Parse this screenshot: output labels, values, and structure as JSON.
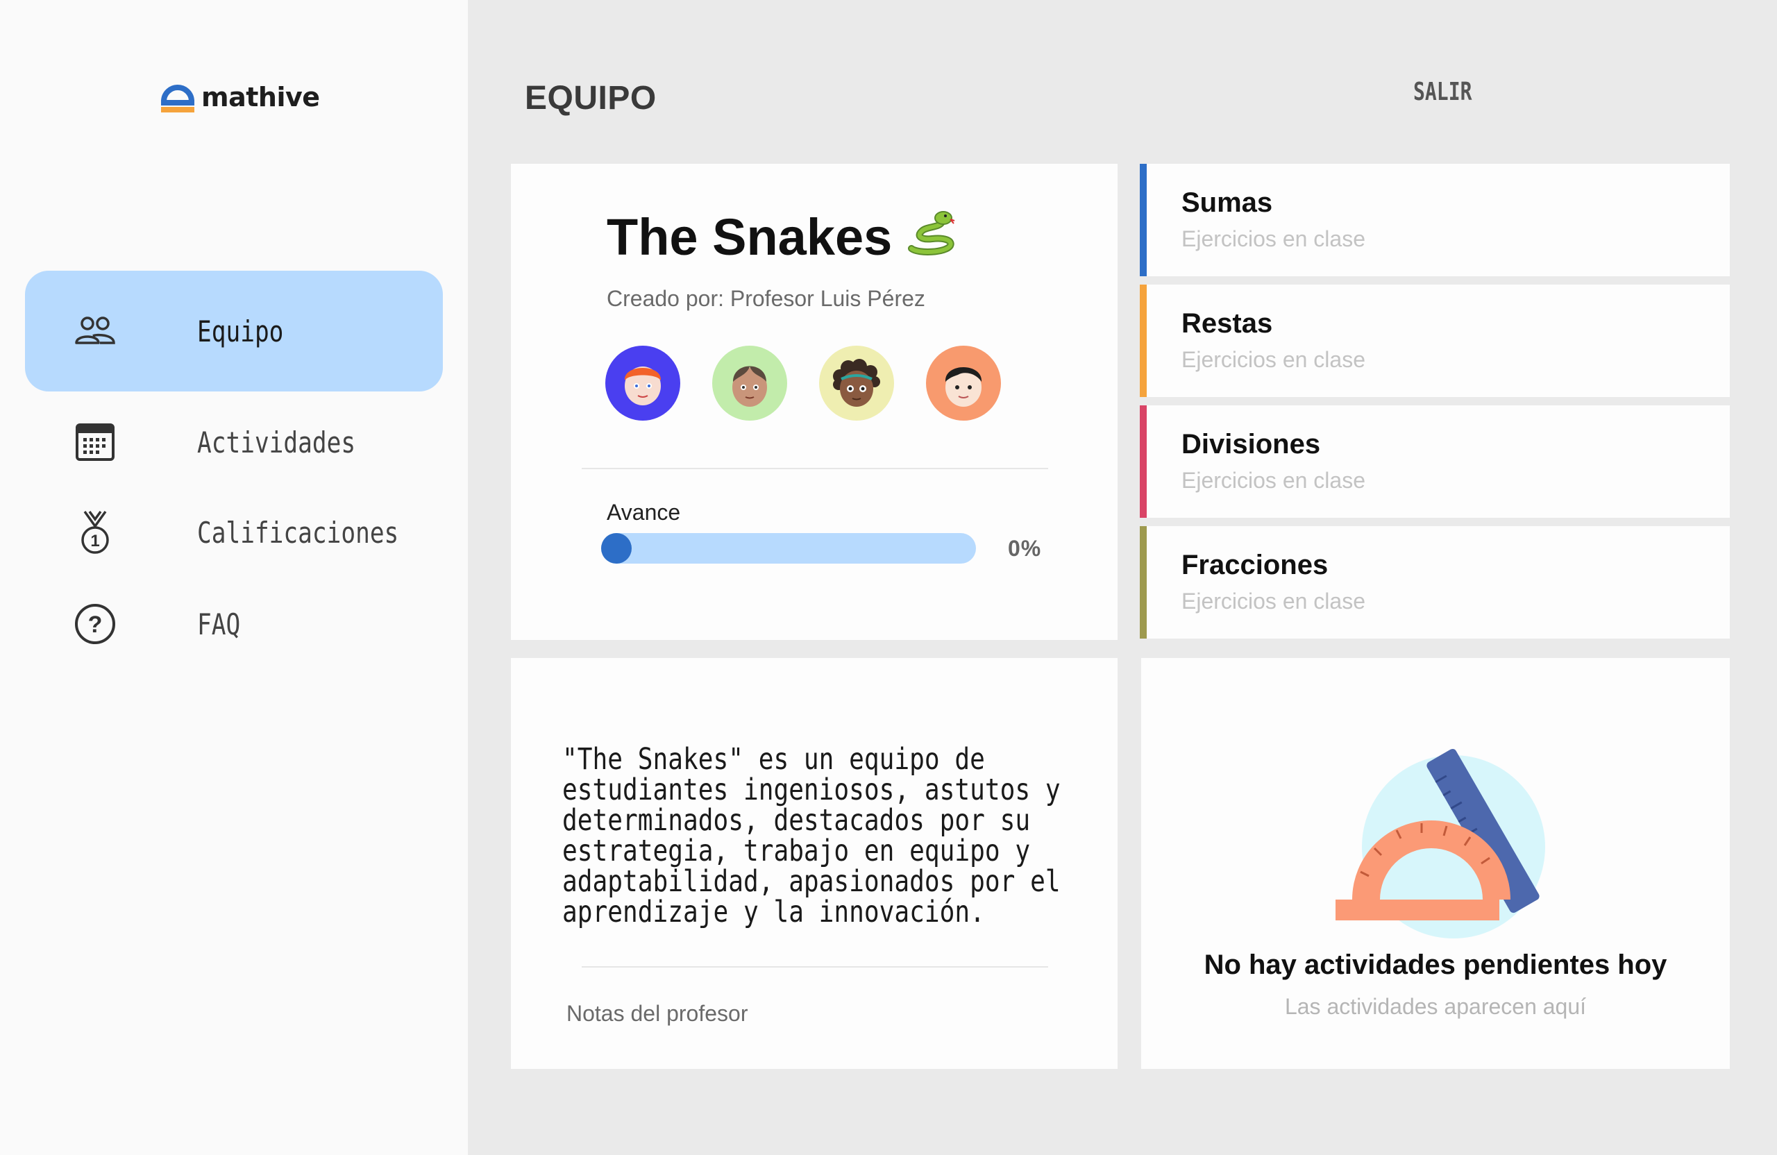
{
  "app": {
    "logo_text": "mathive",
    "brand_colors": {
      "blue": "#2d6ec7",
      "orange": "#f5a33c"
    }
  },
  "sidebar": {
    "items": [
      {
        "label": "Equipo",
        "icon": "users-icon",
        "active": true
      },
      {
        "label": "Actividades",
        "icon": "calendar-icon",
        "active": false
      },
      {
        "label": "Calificaciones",
        "icon": "medal-icon",
        "active": false
      },
      {
        "label": "FAQ",
        "icon": "help-circle-icon",
        "active": false
      }
    ]
  },
  "header": {
    "title": "EQUIPO",
    "logout_label": "SALIR"
  },
  "team": {
    "name": "The Snakes",
    "emoji": "🐍",
    "creator": "Creado por: Profesor Luis Pérez",
    "members": [
      {
        "avatar": "avatar-red-hair-icon",
        "bg": "#4a3ff0"
      },
      {
        "avatar": "avatar-brown-hair-icon",
        "bg": "#c2ecab"
      },
      {
        "avatar": "avatar-curly-hair-icon",
        "bg": "#efeeb1"
      },
      {
        "avatar": "avatar-black-hair-icon",
        "bg": "#f89a6e"
      }
    ],
    "progress_label": "Avance",
    "progress_value": "0%",
    "progress_fraction": 0
  },
  "topics": [
    {
      "title": "Sumas",
      "subtitle": "Ejercicios en clase",
      "color": "#2d6ec7"
    },
    {
      "title": "Restas",
      "subtitle": "Ejercicios en clase",
      "color": "#f5a33c"
    },
    {
      "title": "Divisiones",
      "subtitle": "Ejercicios en clase",
      "color": "#d94466"
    },
    {
      "title": "Fracciones",
      "subtitle": "Ejercicios en clase",
      "color": "#9e9a4e"
    }
  ],
  "notes": {
    "text": "\"The Snakes\" es un equipo de estudiantes ingeniosos, astutos y determinados, destacados por su estrategia, trabajo en equipo y adaptabilidad, apasionados por el aprendizaje y la innovación.",
    "label": "Notas del profesor"
  },
  "activities": {
    "empty_title": "No hay actividades pendientes hoy",
    "empty_subtitle": "Las actividades aparecen aquí",
    "illustration": "protractor-ruler-icon"
  }
}
